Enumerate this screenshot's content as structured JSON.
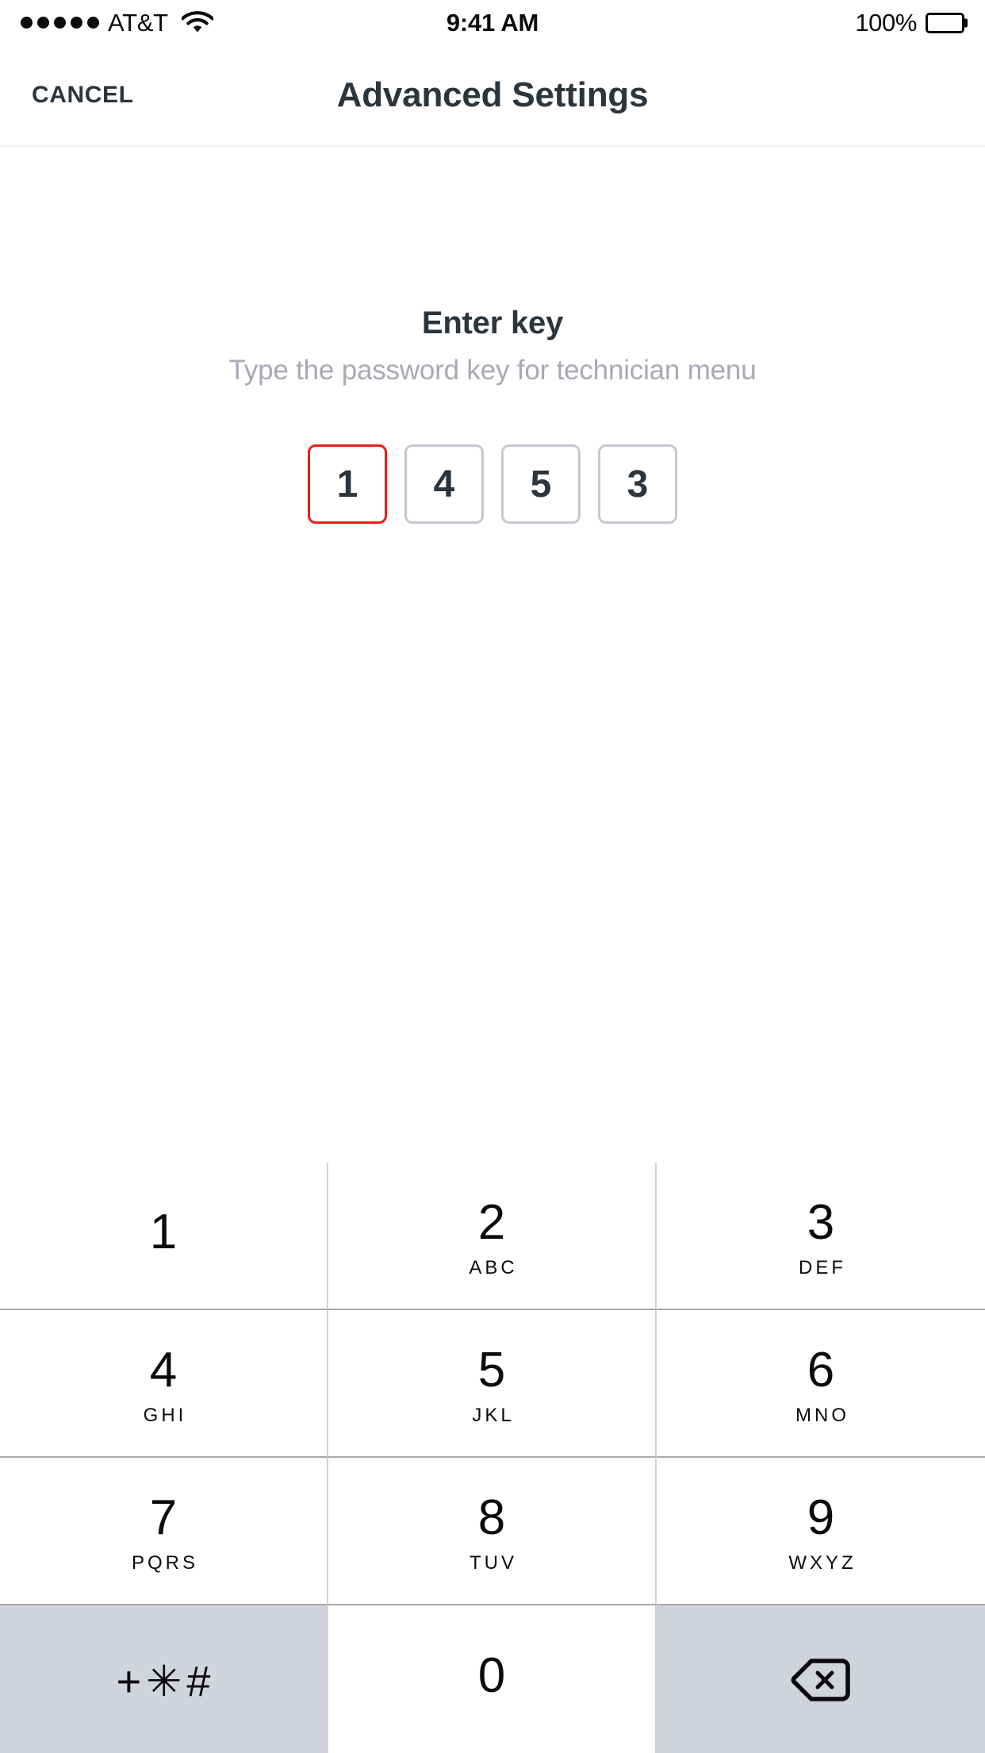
{
  "status_bar": {
    "signal_dots": 5,
    "signal_icon": "signal-dots-icon",
    "carrier": "AT&T",
    "wifi_icon": "wifi-icon",
    "time": "9:41 AM",
    "battery_percent": "100%",
    "battery_icon": "battery-full-icon"
  },
  "nav_bar": {
    "cancel_label": "CANCEL",
    "title": "Advanced Settings"
  },
  "prompt": {
    "title": "Enter key",
    "subtitle": "Type the password key for technician menu"
  },
  "code_entry": {
    "digits": [
      {
        "value": "1",
        "active": true
      },
      {
        "value": "4",
        "active": false
      },
      {
        "value": "5",
        "active": false
      },
      {
        "value": "3",
        "active": false
      }
    ],
    "active_border_color": "#ef1b14",
    "inactive_border_color": "#c8c7d4"
  },
  "keypad": {
    "keys": [
      {
        "digit": "1",
        "letters": ""
      },
      {
        "digit": "2",
        "letters": "ABC"
      },
      {
        "digit": "3",
        "letters": "DEF"
      },
      {
        "digit": "4",
        "letters": "GHI"
      },
      {
        "digit": "5",
        "letters": "JKL"
      },
      {
        "digit": "6",
        "letters": "MNO"
      },
      {
        "digit": "7",
        "letters": "PQRS"
      },
      {
        "digit": "8",
        "letters": "TUV"
      },
      {
        "digit": "9",
        "letters": "WXYZ"
      }
    ],
    "symbols_key": {
      "label": "+✳#",
      "icon": "plus-star-hash-icon"
    },
    "zero_key": {
      "digit": "0",
      "letters": ""
    },
    "delete_key": {
      "icon": "backspace-delete-icon"
    },
    "gray_key_color": "#d1d4da"
  },
  "theme": {
    "text_dark": "#2b353d",
    "text_muted": "#a9a9b5",
    "keypad_text": "#0b0b0b",
    "background": "#ffffff"
  }
}
